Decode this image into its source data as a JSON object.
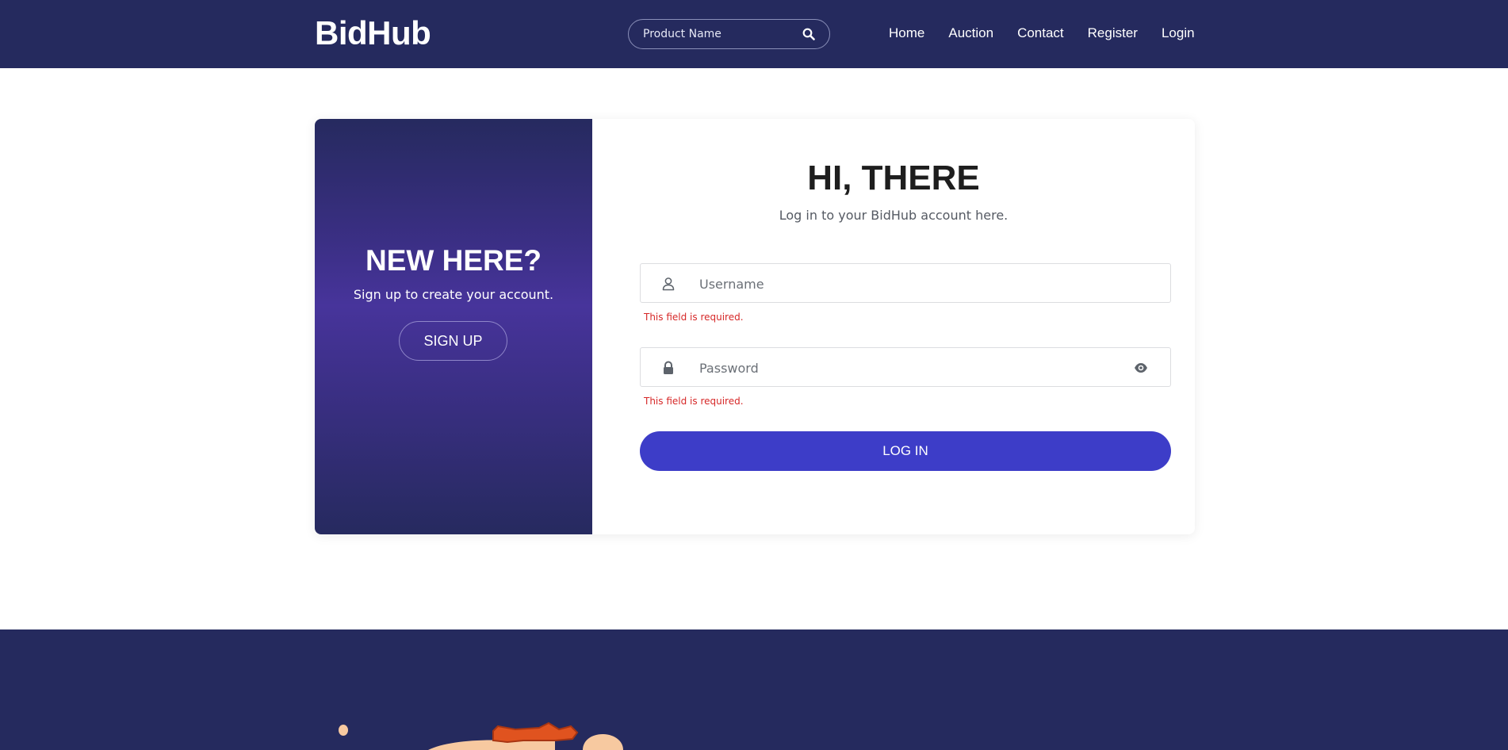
{
  "header": {
    "brand": "BidHub",
    "search": {
      "placeholder": "Product Name"
    },
    "nav": [
      {
        "label": "Home"
      },
      {
        "label": "Auction"
      },
      {
        "label": "Contact"
      },
      {
        "label": "Register"
      },
      {
        "label": "Login"
      }
    ]
  },
  "signup_panel": {
    "heading": "NEW HERE?",
    "text": "Sign up to create your account.",
    "button_label": "SIGN UP"
  },
  "login_panel": {
    "heading": "HI, THERE",
    "subheading": "Log in to your BidHub account here.",
    "username": {
      "placeholder": "Username",
      "value": "",
      "error": "This field is required."
    },
    "password": {
      "placeholder": "Password",
      "value": "",
      "error": "This field is required."
    },
    "submit_label": "LOG IN"
  },
  "colors": {
    "navbar": "#252a5e",
    "accent": "#3d3dc8",
    "error": "#d62828",
    "panel_gradient_mid": "#47349b"
  },
  "icons": {
    "search": "search-icon",
    "user": "user-icon",
    "lock": "lock-icon",
    "eye": "eye-icon"
  }
}
